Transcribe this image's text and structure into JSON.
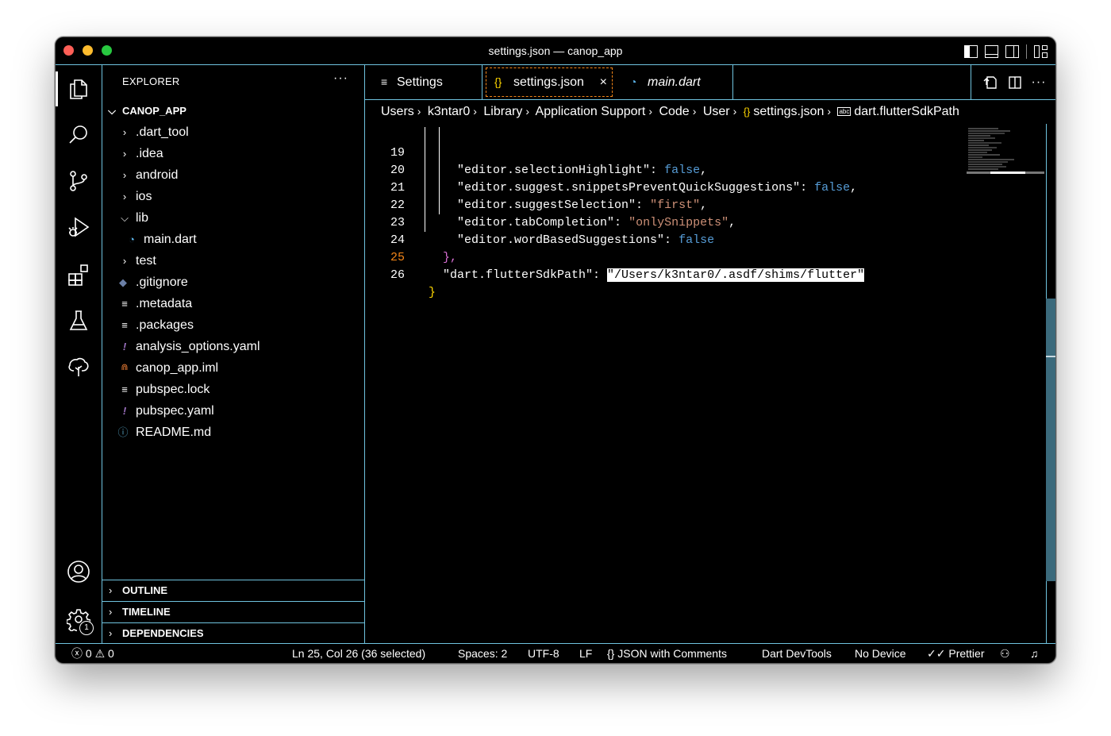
{
  "window": {
    "title": "settings.json — canop_app"
  },
  "explorer": {
    "title": "EXPLORER",
    "more": "···",
    "root": "CANOP_APP",
    "items": [
      {
        "name": ".dart_tool",
        "kind": "folder",
        "depth": 1,
        "expanded": false,
        "icon": "chevron-right-icon"
      },
      {
        "name": ".idea",
        "kind": "folder",
        "depth": 1,
        "expanded": false,
        "icon": "chevron-right-icon"
      },
      {
        "name": "android",
        "kind": "folder",
        "depth": 1,
        "expanded": false,
        "icon": "chevron-right-icon"
      },
      {
        "name": "ios",
        "kind": "folder",
        "depth": 1,
        "expanded": false,
        "icon": "chevron-right-icon"
      },
      {
        "name": "lib",
        "kind": "folder",
        "depth": 1,
        "expanded": true,
        "icon": "chevron-down-icon"
      },
      {
        "name": "main.dart",
        "kind": "file",
        "depth": 2,
        "icon": "dart-file-icon",
        "color": "#5cb3e8"
      },
      {
        "name": "test",
        "kind": "folder",
        "depth": 1,
        "expanded": false,
        "icon": "chevron-right-icon"
      },
      {
        "name": ".gitignore",
        "kind": "file",
        "depth": 1,
        "icon": "git-file-icon",
        "color": "#6b7fa6"
      },
      {
        "name": ".metadata",
        "kind": "file",
        "depth": 1,
        "icon": "lines-file-icon",
        "color": "#ffffff"
      },
      {
        "name": ".packages",
        "kind": "file",
        "depth": 1,
        "icon": "lines-file-icon",
        "color": "#ffffff"
      },
      {
        "name": "analysis_options.yaml",
        "kind": "file",
        "depth": 1,
        "icon": "yaml-file-icon",
        "color": "#a074c4"
      },
      {
        "name": "canop_app.iml",
        "kind": "file",
        "depth": 1,
        "icon": "rss-file-icon",
        "color": "#e37933"
      },
      {
        "name": "pubspec.lock",
        "kind": "file",
        "depth": 1,
        "icon": "lines-file-icon",
        "color": "#ffffff"
      },
      {
        "name": "pubspec.yaml",
        "kind": "file",
        "depth": 1,
        "icon": "yaml-file-icon",
        "color": "#a074c4"
      },
      {
        "name": "README.md",
        "kind": "file",
        "depth": 1,
        "icon": "info-file-icon",
        "color": "#519aba"
      }
    ],
    "sections": [
      "OUTLINE",
      "TIMELINE",
      "DEPENDENCIES"
    ]
  },
  "tabs": [
    {
      "label": "Settings",
      "icon": "settings-list-icon",
      "active": false,
      "italic": false
    },
    {
      "label": "settings.json",
      "icon": "json-braces-icon",
      "active": true,
      "italic": false,
      "close": "×"
    },
    {
      "label": "main.dart",
      "icon": "dart-file-icon",
      "active": false,
      "italic": true
    }
  ],
  "breadcrumbs": [
    "Users",
    "k3ntar0",
    "Library",
    "Application Support",
    "Code",
    "User",
    "settings.json",
    "dart.flutterSdkPath"
  ],
  "code": {
    "current_line": 25,
    "lines": [
      {
        "n": "19",
        "key": "\"editor.selectionHighlight\"",
        "value": "false",
        "vtype": "kw",
        "trail": ","
      },
      {
        "n": "20",
        "key": "\"editor.suggest.snippetsPreventQuickSuggestions\"",
        "value": "false",
        "vtype": "kw",
        "trail": ","
      },
      {
        "n": "21",
        "key": "\"editor.suggestSelection\"",
        "value": "\"first\"",
        "vtype": "str",
        "trail": ","
      },
      {
        "n": "22",
        "key": "\"editor.tabCompletion\"",
        "value": "\"onlySnippets\"",
        "vtype": "str",
        "trail": ","
      },
      {
        "n": "23",
        "key": "\"editor.wordBasedSuggestions\"",
        "value": "false",
        "vtype": "kw",
        "trail": ""
      },
      {
        "n": "24",
        "raw": "},",
        "rtype": "brace2"
      },
      {
        "n": "25",
        "key": "\"dart.flutterSdkPath\"",
        "value": "\"/Users/k3ntar0/.asdf/shims/flutter\"",
        "vtype": "sel",
        "trail": ""
      },
      {
        "n": "26",
        "raw": "}",
        "rtype": "brace"
      }
    ]
  },
  "statusbar": {
    "errors": "0",
    "warnings": "0",
    "position": "Ln 25, Col 26 (36 selected)",
    "spaces": "Spaces: 2",
    "encoding": "UTF-8",
    "eol": "LF",
    "language": "JSON with Comments",
    "devtools": "Dart DevTools",
    "device": "No Device",
    "prettier": "Prettier"
  },
  "activity": {
    "settings_badge": "1"
  }
}
